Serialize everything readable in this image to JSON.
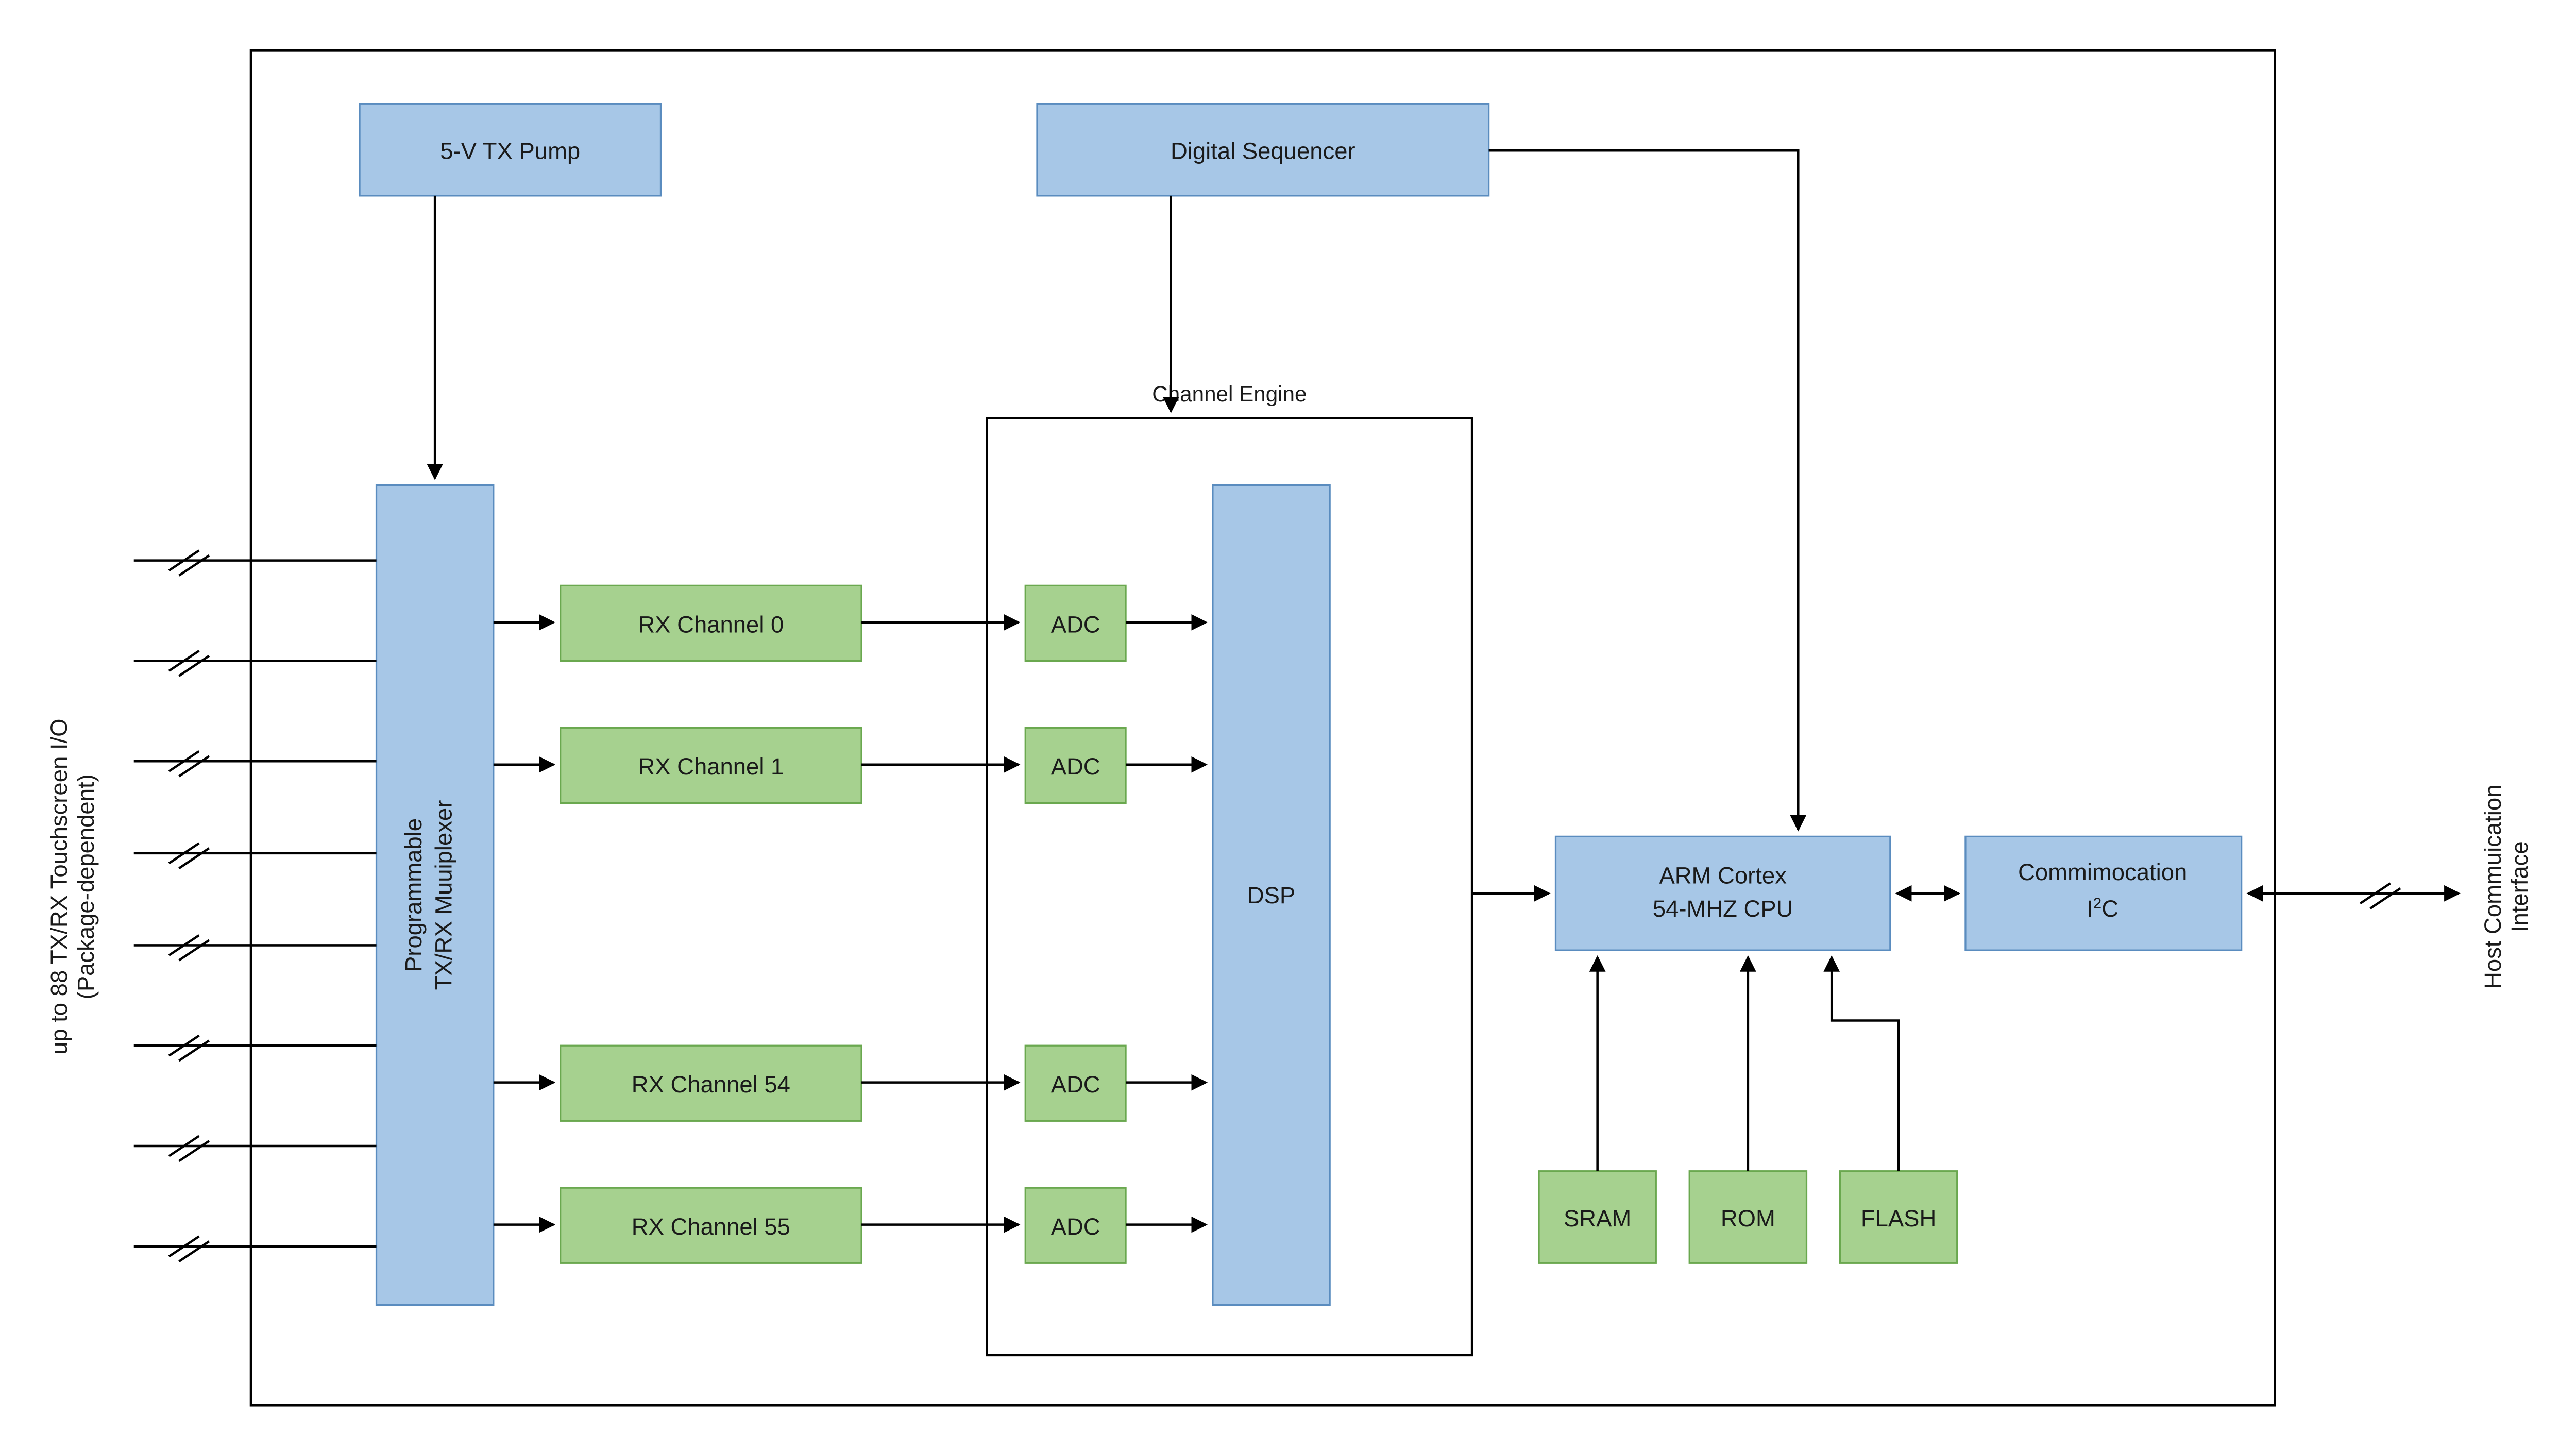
{
  "external_left_label": {
    "line1": "up to 88 TX/RX Touchscreen I/O",
    "line2": "(Package-dependent)"
  },
  "external_right_label": {
    "line1": "Host Commuication",
    "line2": "Interface"
  },
  "blocks": {
    "tx_pump": "5-V TX Pump",
    "digital_seq": "Digital Sequencer",
    "channel_engine_title": "Channel Engine",
    "mux": {
      "line1": "Programmable",
      "line2": "TX/RX Muuiplexer"
    },
    "rx0": "RX Channel 0",
    "rx1": "RX Channel 1",
    "rx54": "RX Channel 54",
    "rx55": "RX Channel 55",
    "adc": "ADC",
    "dsp": "DSP",
    "cpu": {
      "line1": "ARM Cortex",
      "line2": "54-MHZ CPU"
    },
    "comm": {
      "line1": "Commimocation",
      "part_before": "I",
      "part_sup": "2",
      "part_after": "C"
    },
    "sram": "SRAM",
    "rom": "ROM",
    "flash": "FLASH"
  }
}
